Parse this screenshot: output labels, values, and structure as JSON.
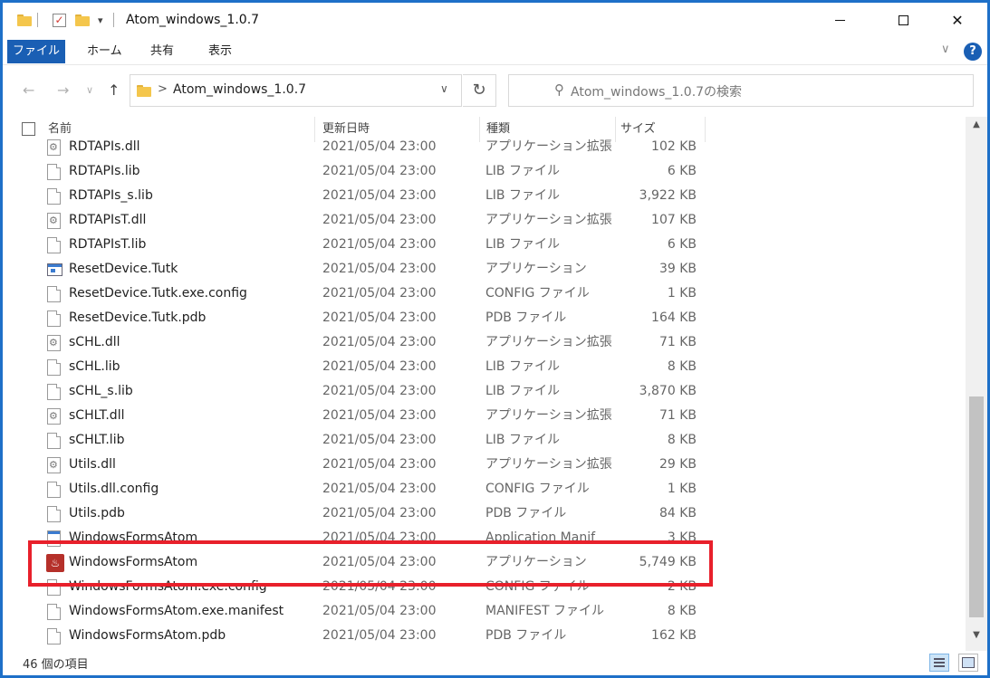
{
  "window": {
    "title": "Atom_windows_1.0.7",
    "close_glyph": "✕"
  },
  "ribbon": {
    "tabs": [
      {
        "label": "ファイル"
      },
      {
        "label": "ホーム"
      },
      {
        "label": "共有"
      },
      {
        "label": "表示"
      }
    ],
    "help_glyph": "?",
    "collapse_glyph": "∨"
  },
  "nav": {
    "back_glyph": "←",
    "forward_glyph": "→",
    "recent_glyph": "∨",
    "up_glyph": "↑",
    "path_separator": ">",
    "path": "Atom_windows_1.0.7",
    "dropdown_glyph": "∨",
    "refresh_glyph": "↻",
    "search_glyph": "⚲",
    "search_placeholder": "Atom_windows_1.0.7の検索"
  },
  "columns": {
    "name": "名前",
    "date": "更新日時",
    "type": "種類",
    "size": "サイズ",
    "sort_glyph": "^"
  },
  "files": [
    {
      "name": "RDTAPIs.dll",
      "date": "2021/05/04 23:00",
      "type": "アプリケーション拡張",
      "size": "102 KB",
      "icon": "dll-icon"
    },
    {
      "name": "RDTAPIs.lib",
      "date": "2021/05/04 23:00",
      "type": "LIB ファイル",
      "size": "6 KB",
      "icon": "file-icon"
    },
    {
      "name": "RDTAPIs_s.lib",
      "date": "2021/05/04 23:00",
      "type": "LIB ファイル",
      "size": "3,922 KB",
      "icon": "file-icon"
    },
    {
      "name": "RDTAPIsT.dll",
      "date": "2021/05/04 23:00",
      "type": "アプリケーション拡張",
      "size": "107 KB",
      "icon": "dll-icon"
    },
    {
      "name": "RDTAPIsT.lib",
      "date": "2021/05/04 23:00",
      "type": "LIB ファイル",
      "size": "6 KB",
      "icon": "file-icon"
    },
    {
      "name": "ResetDevice.Tutk",
      "date": "2021/05/04 23:00",
      "type": "アプリケーション",
      "size": "39 KB",
      "icon": "app-icon"
    },
    {
      "name": "ResetDevice.Tutk.exe.config",
      "date": "2021/05/04 23:00",
      "type": "CONFIG ファイル",
      "size": "1 KB",
      "icon": "file-icon"
    },
    {
      "name": "ResetDevice.Tutk.pdb",
      "date": "2021/05/04 23:00",
      "type": "PDB ファイル",
      "size": "164 KB",
      "icon": "file-icon"
    },
    {
      "name": "sCHL.dll",
      "date": "2021/05/04 23:00",
      "type": "アプリケーション拡張",
      "size": "71 KB",
      "icon": "dll-icon"
    },
    {
      "name": "sCHL.lib",
      "date": "2021/05/04 23:00",
      "type": "LIB ファイル",
      "size": "8 KB",
      "icon": "file-icon"
    },
    {
      "name": "sCHL_s.lib",
      "date": "2021/05/04 23:00",
      "type": "LIB ファイル",
      "size": "3,870 KB",
      "icon": "file-icon"
    },
    {
      "name": "sCHLT.dll",
      "date": "2021/05/04 23:00",
      "type": "アプリケーション拡張",
      "size": "71 KB",
      "icon": "dll-icon"
    },
    {
      "name": "sCHLT.lib",
      "date": "2021/05/04 23:00",
      "type": "LIB ファイル",
      "size": "8 KB",
      "icon": "file-icon"
    },
    {
      "name": "Utils.dll",
      "date": "2021/05/04 23:00",
      "type": "アプリケーション拡張",
      "size": "29 KB",
      "icon": "dll-icon"
    },
    {
      "name": "Utils.dll.config",
      "date": "2021/05/04 23:00",
      "type": "CONFIG ファイル",
      "size": "1 KB",
      "icon": "file-icon"
    },
    {
      "name": "Utils.pdb",
      "date": "2021/05/04 23:00",
      "type": "PDB ファイル",
      "size": "84 KB",
      "icon": "file-icon"
    },
    {
      "name": "WindowsFormsAtom",
      "date": "2021/05/04 23:00",
      "type": "Application Manif",
      "size": "3 KB",
      "icon": "manifest-icon"
    },
    {
      "name": "WindowsFormsAtom",
      "date": "2021/05/04 23:00",
      "type": "アプリケーション",
      "size": "5,749 KB",
      "icon": "atom-app-icon",
      "atom_glyph": "♨"
    },
    {
      "name": "WindowsFormsAtom.exe.config",
      "date": "2021/05/04 23:00",
      "type": "CONFIG ファイル",
      "size": "2 KB",
      "icon": "file-icon"
    },
    {
      "name": "WindowsFormsAtom.exe.manifest",
      "date": "2021/05/04 23:00",
      "type": "MANIFEST ファイル",
      "size": "8 KB",
      "icon": "file-icon"
    },
    {
      "name": "WindowsFormsAtom.pdb",
      "date": "2021/05/04 23:00",
      "type": "PDB ファイル",
      "size": "162 KB",
      "icon": "file-icon"
    }
  ],
  "scrollbar": {
    "up_glyph": "▲",
    "down_glyph": "▼",
    "position_fraction": 0.55
  },
  "status": {
    "item_count": "46 個の項目"
  },
  "colors": {
    "accent": "#1a5fb4",
    "highlight_border": "#e8202b",
    "desktop_border": "#1e70c8"
  }
}
